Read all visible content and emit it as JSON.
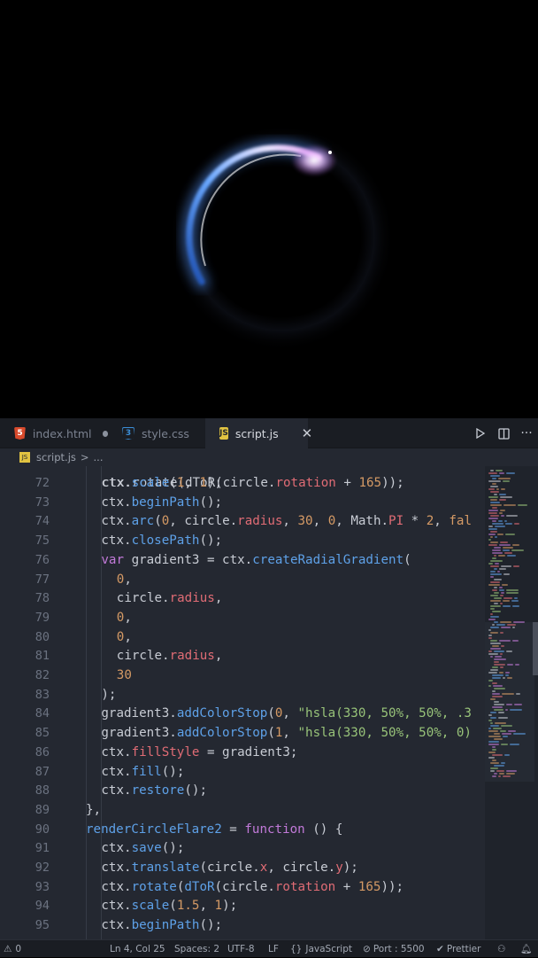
{
  "preview": {
    "colors": {
      "arc_blue": "#4d8ef5",
      "arc_purple": "#d68be8",
      "glow": "#ffffff"
    }
  },
  "tabs": [
    {
      "label": "index.html",
      "icon": "html5-icon",
      "modified": true
    },
    {
      "label": "style.css",
      "icon": "css3-icon"
    },
    {
      "label": "script.js",
      "icon": "js-icon",
      "active": true
    }
  ],
  "tab_actions": {
    "run": "run-icon",
    "split": "split-editor-icon",
    "more": "more-icon",
    "close": "close-icon"
  },
  "breadcrumb": {
    "file": "script.js",
    "separator": ">",
    "rest": "..."
  },
  "code": {
    "first_line_number": 72,
    "lines": [
      {
        "n": "72",
        "indent": 1,
        "tokens": [
          [
            "def",
            "ctx."
          ],
          [
            "fn",
            "scale"
          ],
          [
            "pun",
            "("
          ],
          [
            "num",
            "1"
          ],
          [
            "pun",
            ", "
          ],
          [
            "num",
            "1"
          ],
          [
            "pun",
            ");"
          ]
        ]
      },
      {
        "n": "73",
        "indent": 1,
        "tokens": [
          [
            "def",
            "ctx."
          ],
          [
            "fn",
            "beginPath"
          ],
          [
            "pun",
            "();"
          ]
        ]
      },
      {
        "n": "74",
        "indent": 1,
        "tokens": [
          [
            "def",
            "ctx."
          ],
          [
            "fn",
            "arc"
          ],
          [
            "pun",
            "("
          ],
          [
            "num",
            "0"
          ],
          [
            "pun",
            ", circle."
          ],
          [
            "prop",
            "radius"
          ],
          [
            "pun",
            ", "
          ],
          [
            "num",
            "30"
          ],
          [
            "pun",
            ", "
          ],
          [
            "num",
            "0"
          ],
          [
            "pun",
            ", Math."
          ],
          [
            "prop",
            "PI"
          ],
          [
            "pun",
            " * "
          ],
          [
            "num",
            "2"
          ],
          [
            "pun",
            ", "
          ],
          [
            "num",
            "fal"
          ]
        ]
      },
      {
        "n": "75",
        "indent": 1,
        "tokens": [
          [
            "def",
            "ctx."
          ],
          [
            "fn",
            "closePath"
          ],
          [
            "pun",
            "();"
          ]
        ]
      },
      {
        "n": "76",
        "indent": 1,
        "tokens": [
          [
            "kw",
            "var "
          ],
          [
            "def",
            "gradient3 = ctx."
          ],
          [
            "fn",
            "createRadialGradient"
          ],
          [
            "pun",
            "("
          ]
        ]
      },
      {
        "n": "77",
        "indent": 2,
        "tokens": [
          [
            "num",
            "0"
          ],
          [
            "pun",
            ","
          ]
        ]
      },
      {
        "n": "78",
        "indent": 2,
        "tokens": [
          [
            "def",
            "circle."
          ],
          [
            "prop",
            "radius"
          ],
          [
            "pun",
            ","
          ]
        ]
      },
      {
        "n": "79",
        "indent": 2,
        "tokens": [
          [
            "num",
            "0"
          ],
          [
            "pun",
            ","
          ]
        ]
      },
      {
        "n": "80",
        "indent": 2,
        "tokens": [
          [
            "num",
            "0"
          ],
          [
            "pun",
            ","
          ]
        ]
      },
      {
        "n": "81",
        "indent": 2,
        "tokens": [
          [
            "def",
            "circle."
          ],
          [
            "prop",
            "radius"
          ],
          [
            "pun",
            ","
          ]
        ]
      },
      {
        "n": "82",
        "indent": 2,
        "tokens": [
          [
            "num",
            "30"
          ]
        ]
      },
      {
        "n": "83",
        "indent": 1,
        "tokens": [
          [
            "pun",
            ");"
          ]
        ]
      },
      {
        "n": "84",
        "indent": 1,
        "tokens": [
          [
            "def",
            "gradient3."
          ],
          [
            "fn",
            "addColorStop"
          ],
          [
            "pun",
            "("
          ],
          [
            "num",
            "0"
          ],
          [
            "pun",
            ", "
          ],
          [
            "str",
            "\"hsla(330, 50%, 50%, .3"
          ]
        ]
      },
      {
        "n": "85",
        "indent": 1,
        "tokens": [
          [
            "def",
            "gradient3."
          ],
          [
            "fn",
            "addColorStop"
          ],
          [
            "pun",
            "("
          ],
          [
            "num",
            "1"
          ],
          [
            "pun",
            ", "
          ],
          [
            "str",
            "\"hsla(330, 50%, 50%, 0)"
          ]
        ]
      },
      {
        "n": "86",
        "indent": 1,
        "tokens": [
          [
            "def",
            "ctx."
          ],
          [
            "prop",
            "fillStyle"
          ],
          [
            "pun",
            " = gradient3;"
          ]
        ]
      },
      {
        "n": "87",
        "indent": 1,
        "tokens": [
          [
            "def",
            "ctx."
          ],
          [
            "fn",
            "fill"
          ],
          [
            "pun",
            "();"
          ]
        ]
      },
      {
        "n": "88",
        "indent": 1,
        "tokens": [
          [
            "def",
            "ctx."
          ],
          [
            "fn",
            "restore"
          ],
          [
            "pun",
            "();"
          ]
        ]
      },
      {
        "n": "89",
        "indent": 0,
        "tokens": [
          [
            "pun",
            "},"
          ]
        ]
      },
      {
        "n": "90",
        "indent": 0,
        "tokens": [
          [
            "fn",
            "renderCircleFlare2"
          ],
          [
            "pun",
            " = "
          ],
          [
            "kw",
            "function"
          ],
          [
            "pun",
            " () {"
          ]
        ]
      },
      {
        "n": "91",
        "indent": 1,
        "tokens": [
          [
            "def",
            "ctx."
          ],
          [
            "fn",
            "save"
          ],
          [
            "pun",
            "();"
          ]
        ]
      },
      {
        "n": "92",
        "indent": 1,
        "tokens": [
          [
            "def",
            "ctx."
          ],
          [
            "fn",
            "translate"
          ],
          [
            "pun",
            "(circle."
          ],
          [
            "prop",
            "x"
          ],
          [
            "pun",
            ", circle."
          ],
          [
            "prop",
            "y"
          ],
          [
            "pun",
            ");"
          ]
        ]
      },
      {
        "n": "93",
        "indent": 1,
        "tokens": [
          [
            "def",
            "ctx."
          ],
          [
            "fn",
            "rotate"
          ],
          [
            "pun",
            "("
          ],
          [
            "fn",
            "dToR"
          ],
          [
            "pun",
            "(circle."
          ],
          [
            "prop",
            "rotation"
          ],
          [
            "pun",
            " + "
          ],
          [
            "num",
            "165"
          ],
          [
            "pun",
            "));"
          ]
        ]
      },
      {
        "n": "94",
        "indent": 1,
        "tokens": [
          [
            "def",
            "ctx."
          ],
          [
            "fn",
            "scale"
          ],
          [
            "pun",
            "("
          ],
          [
            "num",
            "1.5"
          ],
          [
            "pun",
            ", "
          ],
          [
            "num",
            "1"
          ],
          [
            "pun",
            ");"
          ]
        ]
      },
      {
        "n": "95",
        "indent": 1,
        "tokens": [
          [
            "def",
            "ctx."
          ],
          [
            "fn",
            "beginPath"
          ],
          [
            "pun",
            "();"
          ]
        ]
      }
    ]
  },
  "status": {
    "problems": "0",
    "cursor": "Ln 4, Col 25",
    "spaces": "Spaces: 2",
    "encoding": "UTF-8",
    "eol": "LF",
    "language": "JavaScript",
    "port": "Port : 5500",
    "prettier": "Prettier"
  }
}
